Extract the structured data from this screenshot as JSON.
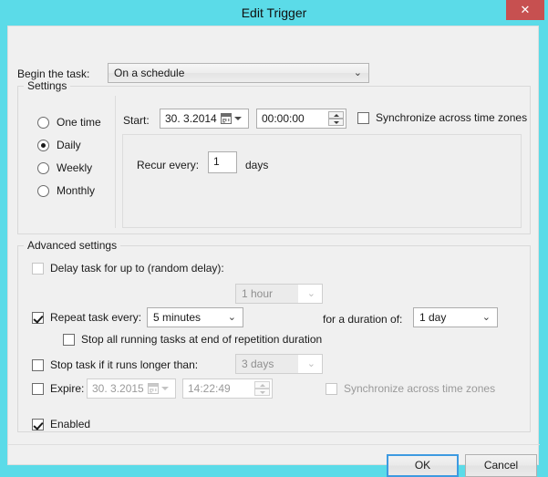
{
  "window": {
    "title": "Edit Trigger",
    "close_label": "✕"
  },
  "begin_task": {
    "label": "Begin the task:",
    "value": "On a schedule",
    "chevron": "⌄"
  },
  "settings": {
    "title": "Settings",
    "schedule_options": [
      {
        "label": "One time",
        "selected": false
      },
      {
        "label": "Daily",
        "selected": true
      },
      {
        "label": "Weekly",
        "selected": false
      },
      {
        "label": "Monthly",
        "selected": false
      }
    ],
    "start_label": "Start:",
    "start_date": "30. 3.2014",
    "start_time": "00:00:00",
    "sync_timezones_label": "Synchronize across time zones",
    "sync_timezones_checked": false,
    "recur_label": "Recur every:",
    "recur_value": "1",
    "recur_unit": "days"
  },
  "advanced": {
    "title": "Advanced settings",
    "delay_label": "Delay task for up to (random delay):",
    "delay_checked": false,
    "delay_value": "1 hour",
    "repeat_label": "Repeat task every:",
    "repeat_checked": true,
    "repeat_value": "5 minutes",
    "duration_label": "for a duration of:",
    "duration_value": "1 day",
    "stop_all_label": "Stop all running tasks at end of repetition duration",
    "stop_all_checked": false,
    "stop_longer_label": "Stop task if it runs longer than:",
    "stop_longer_checked": false,
    "stop_longer_value": "3 days",
    "expire_label": "Expire:",
    "expire_checked": false,
    "expire_date": "30. 3.2015",
    "expire_time": "14:22:49",
    "expire_sync_label": "Synchronize across time zones",
    "expire_sync_checked": false,
    "enabled_label": "Enabled",
    "enabled_checked": true,
    "chevron": "⌄"
  },
  "footer": {
    "ok_label": "OK",
    "cancel_label": "Cancel"
  },
  "colors": {
    "desktop": "#5bdbe8",
    "dialog": "#f0f0f0",
    "close_button": "#c75050",
    "focus_border": "#3d9ae0"
  }
}
